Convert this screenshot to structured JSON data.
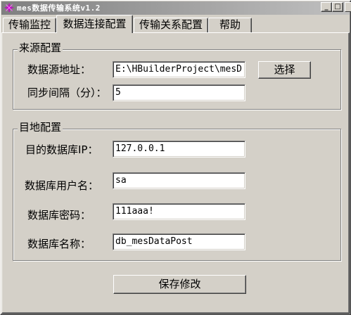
{
  "window": {
    "title": "mes数据传输系统v1.2",
    "controls": {
      "minimize": "_",
      "maximize": "□",
      "close": "×"
    }
  },
  "tabs": [
    {
      "label": "传输监控"
    },
    {
      "label": "数据连接配置",
      "active": true
    },
    {
      "label": "传输关系配置"
    },
    {
      "label": "帮助"
    }
  ],
  "source": {
    "title": "来源配置",
    "path_label": "数据源地址：",
    "path_value": "E:\\HBuilderProject\\mesD",
    "choose_label": "选择",
    "interval_label": "同步间隔（分）：",
    "interval_value": "5"
  },
  "target": {
    "title": "目地配置",
    "ip_label": "目的数据库IP：",
    "ip_value": "127.0.0.1",
    "user_label": "数据库用户名：",
    "user_value": "sa",
    "password_label": "数据库密码：",
    "password_value": "111aaa!",
    "dbname_label": "数据库名称：",
    "dbname_value": "db_mesDataPost"
  },
  "actions": {
    "save_label": "保存修改"
  },
  "colors": {
    "face": "#d4d0c8",
    "titlebar_start": "#808080",
    "titlebar_end": "#c0c0c0",
    "icon_accent": "#c000c0"
  },
  "icons": {
    "app": "app-icon"
  }
}
